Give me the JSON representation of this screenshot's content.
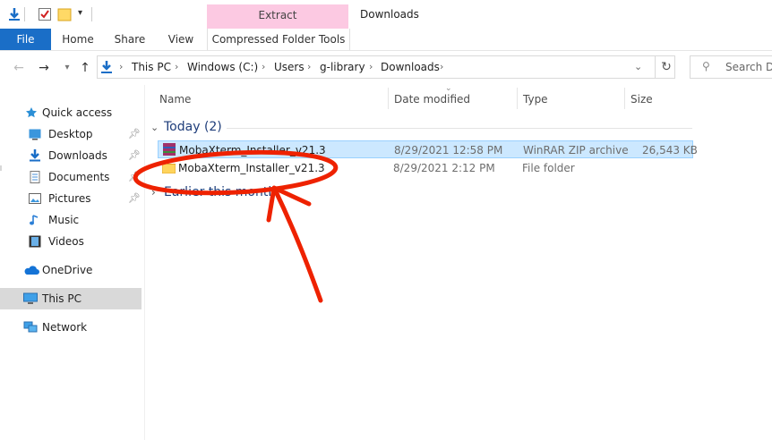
{
  "window": {
    "title": "Downloads"
  },
  "ribbon": {
    "file_tab": "File",
    "tabs": [
      "Home",
      "Share",
      "View"
    ],
    "contextual_group": "Extract",
    "contextual_tab": "Compressed Folder Tools"
  },
  "address": {
    "crumbs": [
      "This PC",
      "Windows (C:)",
      "Users",
      "g-library",
      "Downloads"
    ],
    "search_placeholder": "Search Do"
  },
  "nav": {
    "items": [
      {
        "label": "Quick access",
        "icon": "star-icon"
      },
      {
        "label": "Desktop",
        "icon": "desktop-icon",
        "pinned": true
      },
      {
        "label": "Downloads",
        "icon": "download-icon",
        "pinned": true
      },
      {
        "label": "Documents",
        "icon": "documents-icon",
        "pinned": true
      },
      {
        "label": "Pictures",
        "icon": "pictures-icon",
        "pinned": true
      },
      {
        "label": "Music",
        "icon": "music-icon"
      },
      {
        "label": "Videos",
        "icon": "videos-icon"
      },
      {
        "label": "OneDrive",
        "icon": "cloud-icon"
      },
      {
        "label": "This PC",
        "icon": "computer-icon",
        "selected": true
      },
      {
        "label": "Network",
        "icon": "network-icon"
      }
    ]
  },
  "columns": {
    "name": "Name",
    "date": "Date modified",
    "type": "Type",
    "size": "Size"
  },
  "groups": {
    "today": "Today (2)",
    "earlier": "Earlier this month"
  },
  "files": [
    {
      "name": "MobaXterm_Installer_v21.3",
      "date": "8/29/2021 12:58 PM",
      "type": "WinRAR ZIP archive",
      "size": "26,543 KB"
    },
    {
      "name": "MobaXterm_Installer_v21.3",
      "date": "8/29/2021 2:12 PM",
      "type": "File folder",
      "size": ""
    }
  ],
  "colors": {
    "accent": "#1a6ec7",
    "annotation": "#ee2200",
    "selection": "#cce8ff",
    "context_tab": "#fcc9e2"
  }
}
